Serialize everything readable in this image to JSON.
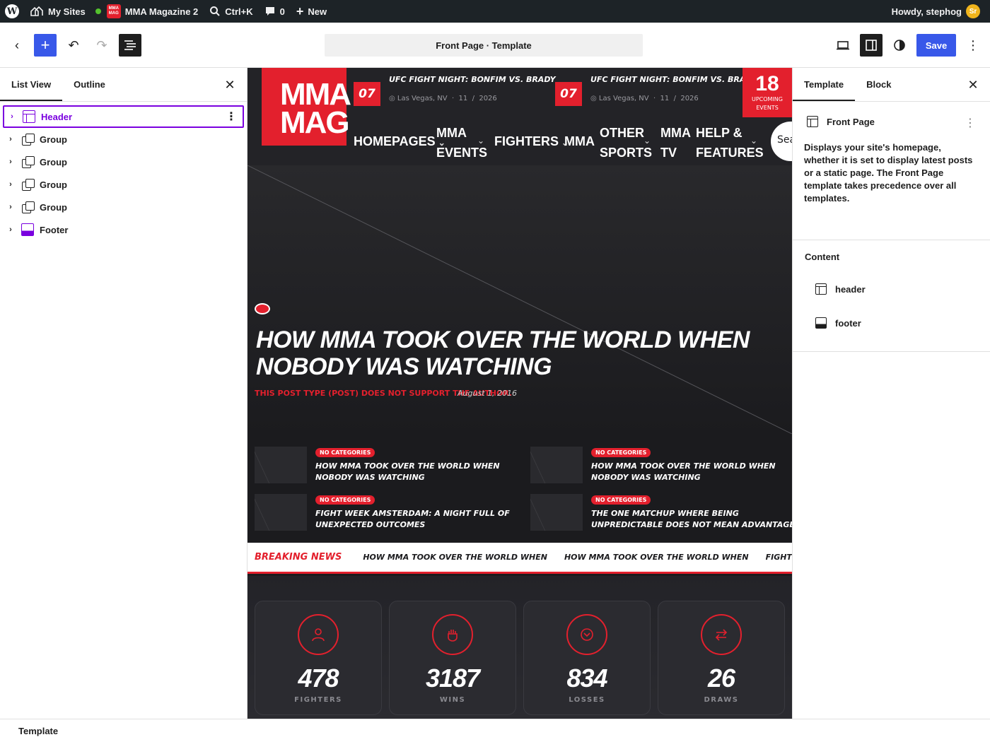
{
  "adminbar": {
    "wp_logo": "wordpress-icon",
    "my_sites": "My Sites",
    "site_name": "MMA Magazine 2",
    "site_icon_text": "MMA MAG",
    "search": "Ctrl+K",
    "comments_count": "0",
    "new": "New",
    "howdy": "Howdy, stephog",
    "avatar_text": "Sr"
  },
  "toolbar": {
    "document_title": "Front Page · Template",
    "save_label": "Save"
  },
  "list_view": {
    "tabs": [
      {
        "label": "List View"
      },
      {
        "label": "Outline"
      }
    ],
    "items": [
      {
        "label": "Header"
      },
      {
        "label": "Group"
      },
      {
        "label": "Group"
      },
      {
        "label": "Group"
      },
      {
        "label": "Group"
      },
      {
        "label": "Footer"
      }
    ]
  },
  "canvas": {
    "logo": {
      "line1": "MMA",
      "line2": "MAG"
    },
    "events": [
      {
        "day": "07",
        "title": "UFC FIGHT NIGHT: BONFIM VS. BRADY",
        "location": "Las Vegas, NV",
        "month": "11",
        "year": "2026"
      },
      {
        "day": "07",
        "title": "UFC FIGHT NIGHT: BONFIM VS. BRADY",
        "location": "Las Vegas, NV",
        "month": "11",
        "year": "2026"
      }
    ],
    "upcoming": {
      "count": "18",
      "label_line1": "UPCOMING",
      "label_line2": "EVENTS"
    },
    "nav": [
      {
        "line1": "HOMEPAGES",
        "line2": ""
      },
      {
        "line1": "MMA",
        "line2": "EVENTS"
      },
      {
        "line1": "FIGHTERS",
        "line2": ""
      },
      {
        "line1": "MMA",
        "line2": ""
      },
      {
        "line1": "OTHER",
        "line2": "SPORTS"
      },
      {
        "line1": "MMA",
        "line2": "TV"
      },
      {
        "line1": "HELP &",
        "line2": "FEATURES"
      }
    ],
    "search_text": "Sear",
    "hero": {
      "title": "HOW MMA TOOK OVER THE WORLD WHEN NOBODY WAS WATCHING",
      "author_notice": "THIS POST TYPE (POST) DOES NOT SUPPORT THE AUTHOR.",
      "date": "August 1, 2016"
    },
    "posts": [
      {
        "category": "NO CATEGORIES",
        "title": "HOW MMA TOOK OVER THE WORLD WHEN NOBODY WAS WATCHING"
      },
      {
        "category": "NO CATEGORIES",
        "title": "HOW MMA TOOK OVER THE WORLD WHEN NOBODY WAS WATCHING"
      },
      {
        "category": "NO CATEGORIES",
        "title": "FIGHT WEEK AMSTERDAM: A NIGHT FULL OF UNEXPECTED OUTCOMES"
      },
      {
        "category": "NO CATEGORIES",
        "title": "THE ONE MATCHUP WHERE BEING UNPREDICTABLE DOES NOT MEAN ADVANTAGE"
      }
    ],
    "breaking": {
      "label": "BREAKING NEWS",
      "items": [
        "HOW MMA TOOK OVER THE WORLD WHEN",
        "HOW MMA TOOK OVER THE WORLD WHEN",
        "FIGHT WEEK AMSTERDAM: A NIGHT FULL"
      ]
    },
    "stats": [
      {
        "value": "478",
        "label": "FIGHTERS",
        "icon": "user-icon"
      },
      {
        "value": "3187",
        "label": "WINS",
        "icon": "fist-icon"
      },
      {
        "value": "834",
        "label": "LOSSES",
        "icon": "chevron-circle-icon"
      },
      {
        "value": "26",
        "label": "DRAWS",
        "icon": "swap-arrows-icon"
      }
    ]
  },
  "settings": {
    "tabs": [
      {
        "label": "Template"
      },
      {
        "label": "Block"
      }
    ],
    "template_name": "Front Page",
    "description": "Displays your site's homepage, whether it is set to display latest posts or a static page. The Front Page template takes precedence over all templates.",
    "content_title": "Content",
    "content_items": [
      {
        "label": "header"
      },
      {
        "label": "footer"
      }
    ]
  },
  "statusbar": {
    "breadcrumb": "Template"
  },
  "colors": {
    "accent": "#3858e9",
    "selection": "#7a00df",
    "brand_red": "#e3202d"
  }
}
